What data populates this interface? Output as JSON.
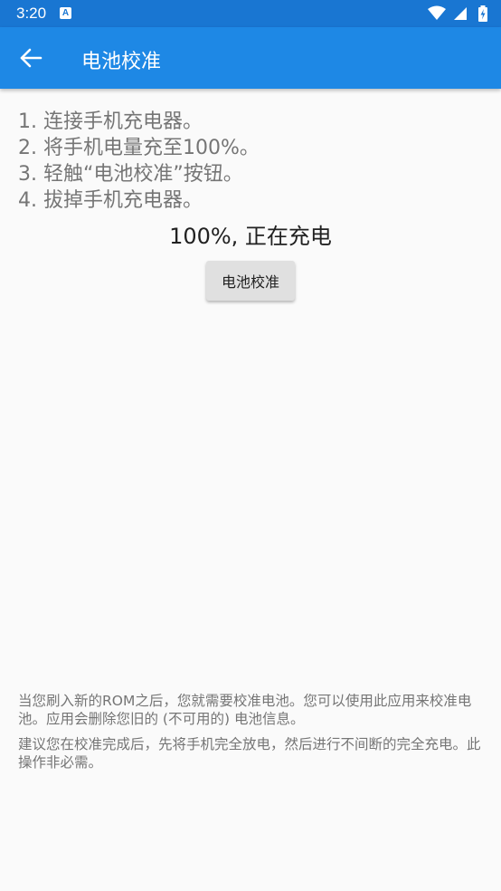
{
  "status_bar": {
    "time": "3:20",
    "notification_icon_letter": "A",
    "background_color": "#1976d2",
    "icons": [
      "wifi-icon",
      "signal-icon",
      "battery-charging-icon"
    ]
  },
  "app_bar": {
    "title": "电池校准",
    "background_color": "#1e88e5",
    "back_icon": "arrow-left-icon"
  },
  "instructions": [
    "1. 连接手机充电器。",
    "2. 将手机电量充至100%。",
    "3. 轻触“电池校准”按钮。",
    "4. 拔掉手机充电器。"
  ],
  "battery_status": "100%, 正在充电",
  "calibrate_button_label": "电池校准",
  "notes": {
    "first": "当您刷入新的ROM之后，您就需要校准电池。您可以使用此应用来校准电池。应用会删除您旧的 (不可用的) 电池信息。",
    "second": "建议您在校准完成后，先将手机完全放电，然后进行不间断的完全充电。此操作非必需。"
  }
}
